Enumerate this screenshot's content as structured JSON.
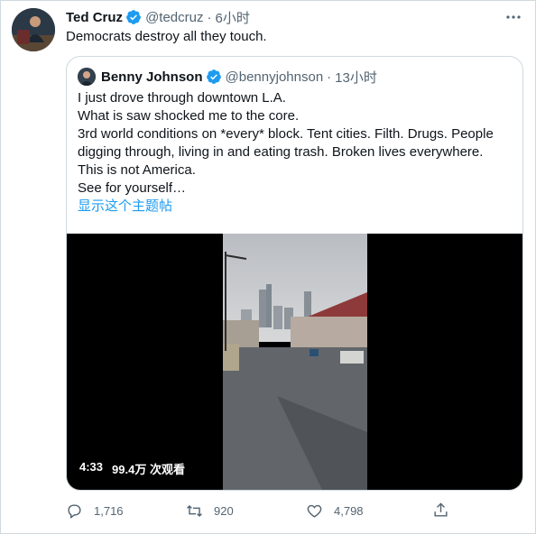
{
  "tweet": {
    "author_name": "Ted Cruz",
    "author_handle": "@tedcruz",
    "separator": "·",
    "time": "6小时",
    "text": "Democrats destroy all they touch."
  },
  "quote": {
    "author_name": "Benny Johnson",
    "author_handle": "@bennyjohnson",
    "separator": "·",
    "time": "13小时",
    "lines": [
      "I just drove through downtown L.A.",
      "What is saw shocked me to the core.",
      "3rd world conditions on *every* block. Tent cities. Filth. Drugs. People",
      "digging through, living in and eating trash. Broken lives everywhere.",
      "This is not America.",
      "See for yourself…"
    ],
    "show_thread": "显示这个主题帖",
    "video": {
      "duration": "4:33",
      "views": "99.4万 次观看"
    }
  },
  "actions": {
    "replies": "1,716",
    "retweets": "920",
    "likes": "4,798"
  },
  "colors": {
    "accent": "#1d9bf0",
    "muted": "#536471",
    "border": "#cfd9de"
  }
}
